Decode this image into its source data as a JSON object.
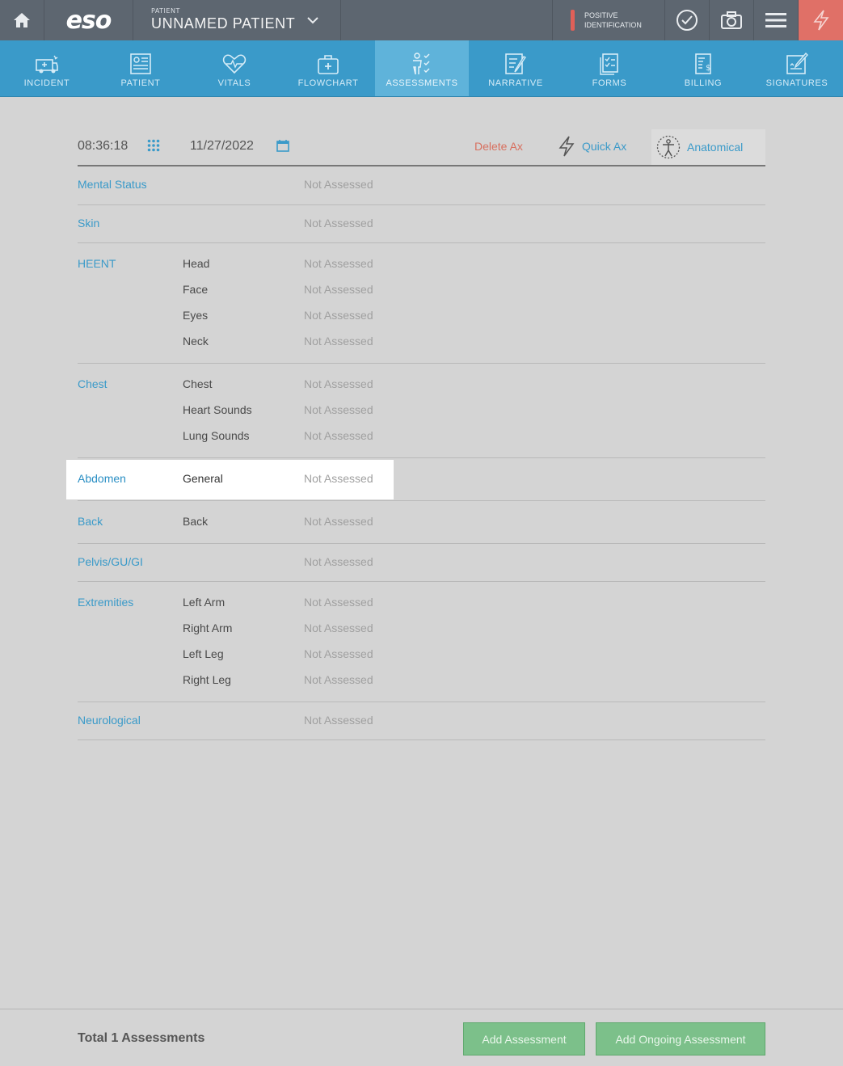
{
  "topbar": {
    "logo": "eso",
    "patient_caption": "PATIENT",
    "patient_name": "UNNAMED PATIENT",
    "positive_id_line1": "POSITIVE",
    "positive_id_line2": "IDENTIFICATION"
  },
  "nav": {
    "tabs": [
      {
        "label": "INCIDENT",
        "icon": "ambulance-icon"
      },
      {
        "label": "PATIENT",
        "icon": "patient-card-icon"
      },
      {
        "label": "VITALS",
        "icon": "heart-pulse-icon"
      },
      {
        "label": "FLOWCHART",
        "icon": "medkit-icon"
      },
      {
        "label": "ASSESSMENTS",
        "icon": "assessment-person-icon",
        "active": true
      },
      {
        "label": "NARRATIVE",
        "icon": "narrative-edit-icon"
      },
      {
        "label": "FORMS",
        "icon": "forms-checklist-icon"
      },
      {
        "label": "BILLING",
        "icon": "billing-icon"
      },
      {
        "label": "SIGNATURES",
        "icon": "signature-icon"
      }
    ]
  },
  "toolbar": {
    "time": "08:36:18",
    "date": "11/27/2022",
    "delete_label": "Delete Ax",
    "quick_label": "Quick Ax",
    "anatomical_label": "Anatomical"
  },
  "assessment": {
    "not_assessed": "Not Assessed",
    "categories": [
      {
        "name": "Mental Status",
        "items": [
          ""
        ]
      },
      {
        "name": "Skin",
        "items": [
          ""
        ]
      },
      {
        "name": "HEENT",
        "items": [
          "Head",
          "Face",
          "Eyes",
          "Neck"
        ]
      },
      {
        "name": "Chest",
        "items": [
          "Chest",
          "Heart Sounds",
          "Lung Sounds"
        ]
      },
      {
        "name": "Abdomen",
        "items": [
          "General"
        ],
        "selected": true
      },
      {
        "name": "Back",
        "items": [
          "Back"
        ]
      },
      {
        "name": "Pelvis/GU/GI",
        "items": [
          ""
        ]
      },
      {
        "name": "Extremities",
        "items": [
          "Left Arm",
          "Right Arm",
          "Left Leg",
          "Right Leg"
        ]
      },
      {
        "name": "Neurological",
        "items": [
          ""
        ]
      }
    ]
  },
  "footer": {
    "total_label": "Total 1 Assessments",
    "add_label": "Add Assessment",
    "add_ongoing_label": "Add Ongoing Assessment"
  },
  "colors": {
    "topbar": "#5d6670",
    "nav": "#3a9ac9",
    "nav_active": "#5fb3da",
    "accent_red": "#e07067",
    "link_blue": "#3a9ac9",
    "button_green": "#7cc08a"
  }
}
